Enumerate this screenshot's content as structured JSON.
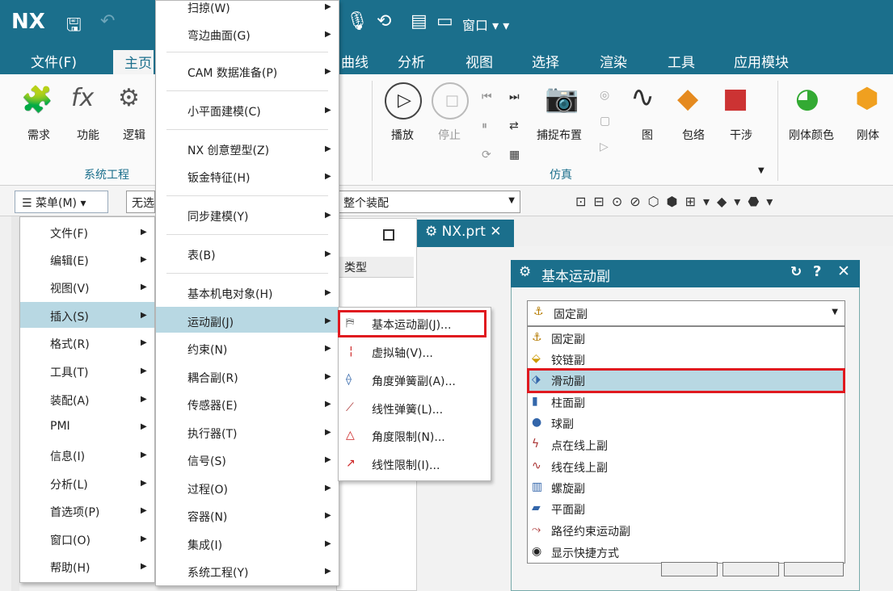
{
  "app": {
    "logo": "NX",
    "window_menu": "窗口"
  },
  "menubar": {
    "tabs": [
      "文件(F)",
      "主页",
      "曲线",
      "分析",
      "视图",
      "选择",
      "渲染",
      "工具",
      "应用模块"
    ]
  },
  "ribbon": {
    "left_buttons": [
      "需求",
      "功能",
      "逻辑"
    ],
    "group_system": "系统工程",
    "sim_buttons": [
      "播放",
      "停止",
      "捕捉布置",
      "图",
      "包络",
      "干涉"
    ],
    "group_sim": "仿真",
    "right_buttons": [
      "刚体颜色",
      "刚体"
    ]
  },
  "toolbar2": {
    "menu_button": "菜单(M)",
    "filter_value": "无选",
    "assembly_scope": "整个装配"
  },
  "nav": {
    "col_type": "类型"
  },
  "doc_tab": {
    "label": "NX.prt"
  },
  "main_menu": {
    "items": [
      "文件(F)",
      "编辑(E)",
      "视图(V)",
      "插入(S)",
      "格式(R)",
      "工具(T)",
      "装配(A)",
      "PMI",
      "信息(I)",
      "分析(L)",
      "首选项(P)",
      "窗口(O)",
      "帮助(H)"
    ],
    "highlighted": "插入(S)"
  },
  "insert_menu": {
    "items": [
      "扫掠(W)",
      "弯边曲面(G)",
      "CAM 数据准备(P)",
      "小平面建模(C)",
      "NX 创意塑型(Z)",
      "钣金特征(H)",
      "同步建模(Y)",
      "表(B)",
      "基本机电对象(H)",
      "运动副(J)",
      "约束(N)",
      "耦合副(R)",
      "传感器(E)",
      "执行器(T)",
      "信号(S)",
      "过程(O)",
      "容器(N)",
      "集成(I)",
      "系统工程(Y)"
    ],
    "highlighted": "运动副(J)"
  },
  "joint_menu": {
    "items": [
      "基本运动副(J)...",
      "虚拟轴(V)...",
      "角度弹簧副(A)...",
      "线性弹簧(L)...",
      "角度限制(N)...",
      "线性限制(I)..."
    ],
    "highlighted": "基本运动副(J)..."
  },
  "dialog": {
    "title": "基本运动副",
    "selected": "固定副",
    "options": [
      "固定副",
      "铰链副",
      "滑动副",
      "柱面副",
      "球副",
      "点在线上副",
      "线在线上副",
      "螺旋副",
      "平面副",
      "路径约束运动副",
      "显示快捷方式"
    ],
    "highlighted": "滑动副"
  },
  "colors": {
    "brand": "#1b6f8c",
    "highlight": "#b8d8e3",
    "annotation_red": "#e0191f"
  }
}
